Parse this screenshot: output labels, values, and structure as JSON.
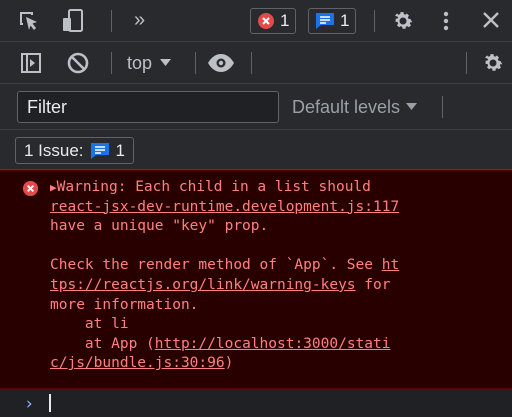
{
  "toolbar": {
    "more_tabs": "»",
    "error_count": "1",
    "message_count": "1"
  },
  "console_toolbar": {
    "context": "top"
  },
  "filter": {
    "placeholder": "Filter",
    "levels": "Default levels"
  },
  "issues": {
    "label": "1 Issue:",
    "count": "1"
  },
  "message": {
    "line1": "Warning: Each child in a list should",
    "source_link": "react-jsx-dev-runtime.development.js:117",
    "line3": "have a unique \"key\" prop.",
    "line5_pre": "Check the render method of `App`. See ",
    "line5_link": "ht",
    "line6_link": "tps://reactjs.org/link/warning-keys",
    "line6_post": " for",
    "line7": "more information.",
    "line8": "    at li",
    "line9_pre": "    at App (",
    "line9_link": "http://localhost:3000/stati",
    "line10_link": "c/js/bundle.js:30:96",
    "line10_post": ")"
  },
  "prompt": {
    "caret": "›"
  },
  "colors": {
    "error_red": "#e24b4b",
    "message_blue": "#1a73e8",
    "error_text": "#ff8080",
    "error_bg": "#290000"
  }
}
